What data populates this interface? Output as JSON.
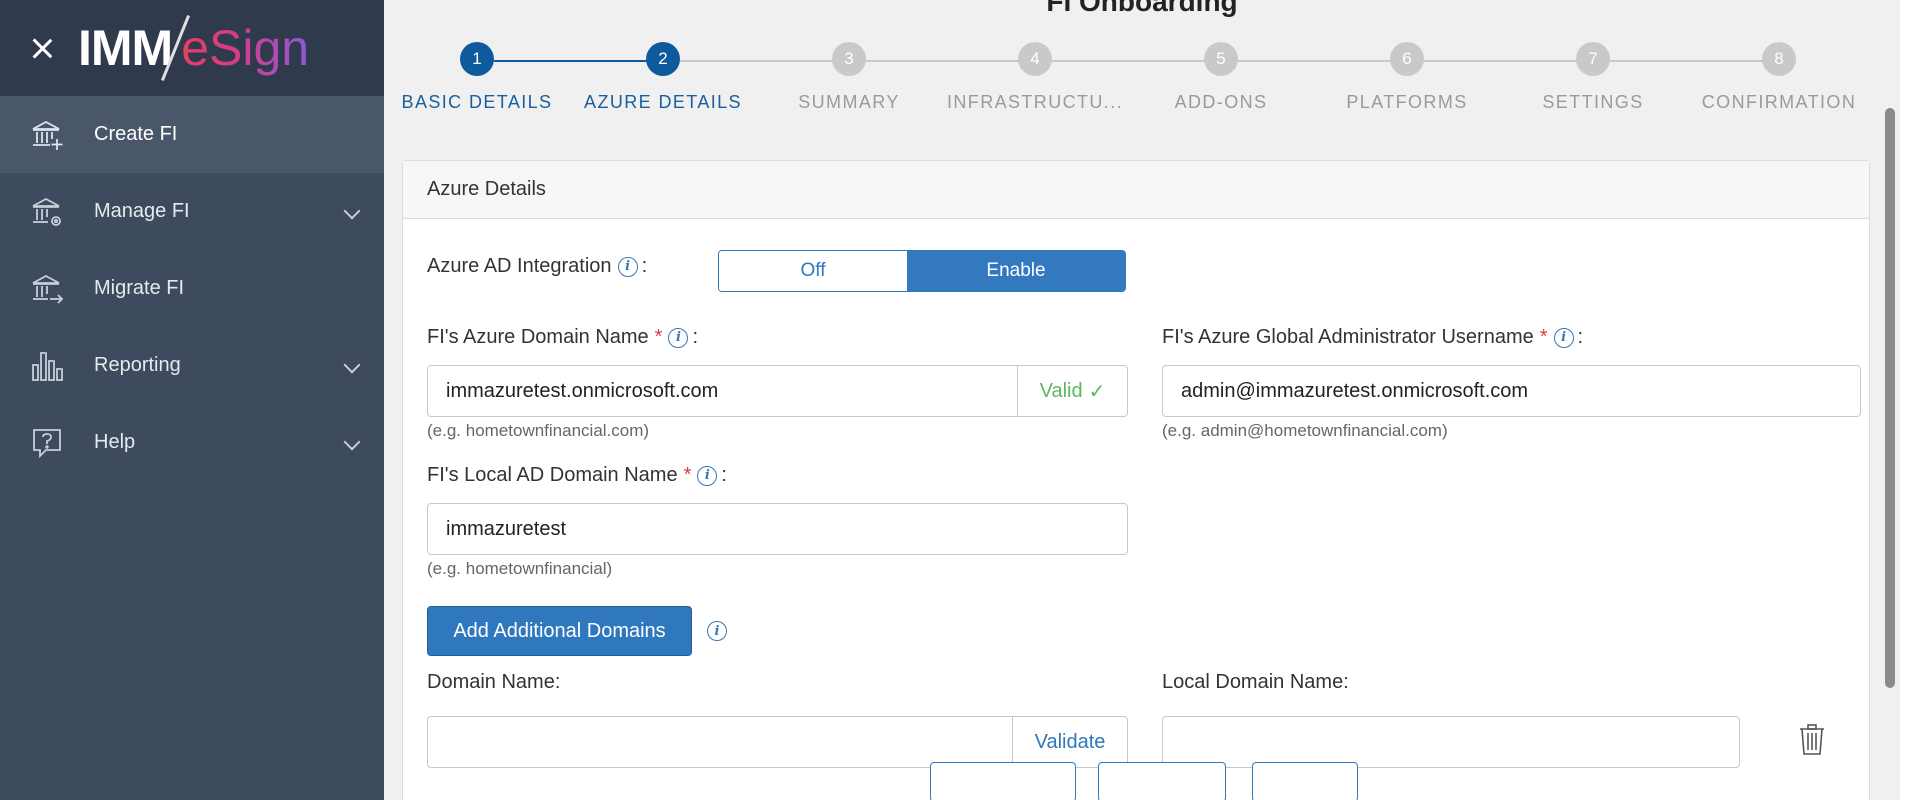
{
  "app": {
    "logo_left": "IMM",
    "logo_right": "eSign",
    "brand_colors": {
      "sidebar": "#3e4a5e",
      "sidebar_header": "#2f3a4d",
      "primary": "#2f78bd",
      "valid": "#5cb85c"
    }
  },
  "sidebar": {
    "items": [
      {
        "label": "Create FI",
        "icon": "bank-plus-icon"
      },
      {
        "label": "Manage FI",
        "icon": "bank-gear-icon"
      },
      {
        "label": "Migrate FI",
        "icon": "bank-arrow-icon"
      },
      {
        "label": "Reporting",
        "icon": "bar-chart-icon"
      },
      {
        "label": "Help",
        "icon": "help-bubble-icon"
      }
    ]
  },
  "main": {
    "title": "FI Onboarding",
    "steps": [
      {
        "num": "1",
        "label": "BASIC DETAILS"
      },
      {
        "num": "2",
        "label": "AZURE DETAILS"
      },
      {
        "num": "3",
        "label": "SUMMARY"
      },
      {
        "num": "4",
        "label": "INFRASTRUCTU..."
      },
      {
        "num": "5",
        "label": "ADD-ONS"
      },
      {
        "num": "6",
        "label": "PLATFORMS"
      },
      {
        "num": "7",
        "label": "SETTINGS"
      },
      {
        "num": "8",
        "label": "CONFIRMATION"
      }
    ],
    "card": {
      "header": "Azure Details",
      "ad_integration": {
        "label": "Azure AD Integration",
        "off_label": "Off",
        "on_label": "Enable",
        "selected": "Enable"
      },
      "azure_domain": {
        "label": "FI's Azure Domain Name",
        "value": "immazuretest.onmicrosoft.com",
        "status": "Valid",
        "hint": "(e.g. hometownfinancial.com)"
      },
      "admin_username": {
        "label": "FI's Azure Global Administrator Username",
        "value": "admin@immazuretest.onmicrosoft.com",
        "hint": "(e.g. admin@hometownfinancial.com)"
      },
      "local_domain": {
        "label": "FI's Local AD Domain Name",
        "value": "immazuretest",
        "hint": "(e.g. hometownfinancial)"
      },
      "add_domains_label": "Add Additional Domains",
      "domain_name_label": "Domain Name:",
      "validate_label": "Validate",
      "local_domain_name_label": "Local Domain Name:"
    }
  }
}
